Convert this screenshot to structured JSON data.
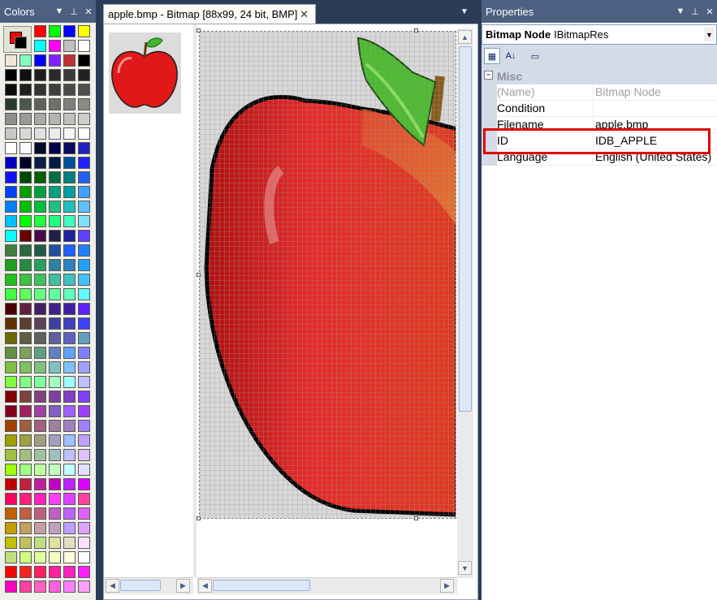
{
  "colors_pane": {
    "title": "Colors",
    "palette": [
      [
        "#ff0000",
        "#00ff00",
        "#0000ff",
        "#ffff00"
      ],
      [
        "#00ffff",
        "#ff00ff",
        "#c0c0c0",
        "#ffffff"
      ],
      [
        "#f3e6d3",
        "#80ffc0",
        "#0000ff",
        "#8020ff",
        "#c03030",
        "#000000"
      ],
      [
        "#000000",
        "#101010",
        "#1e1e1e",
        "#2a2a2a",
        "#3a3a3a",
        "#222222"
      ],
      [
        "#0c0c0c",
        "#202020",
        "#333333",
        "#404040",
        "#4a4a4a",
        "#505050"
      ],
      [
        "#2b3a2a",
        "#4a5a4a",
        "#606060",
        "#707070",
        "#808080",
        "#8a8a8a"
      ],
      [
        "#8f8f8f",
        "#9a9a9a",
        "#a8a8a8",
        "#b4b4b4",
        "#c0c0c0",
        "#cccccc"
      ],
      [
        "#c8c8c8",
        "#d8d8d8",
        "#e0e0e0",
        "#ececec",
        "#f6f6f6",
        "#ffffff"
      ],
      [
        "#ffffff",
        "#fafafa",
        "#000a2a",
        "#00004a",
        "#0a0a60",
        "#2020c0"
      ],
      [
        "#0000c0",
        "#00002a",
        "#0a1a4a",
        "#001a40",
        "#0050a0",
        "#2020ff"
      ],
      [
        "#1010ff",
        "#004a00",
        "#006000",
        "#007040",
        "#008080",
        "#2060ff"
      ],
      [
        "#0040ff",
        "#00a000",
        "#00a040",
        "#00a080",
        "#00a0a0",
        "#40a0ff"
      ],
      [
        "#0080ff",
        "#00c000",
        "#00c040",
        "#20c080",
        "#20c0c0",
        "#60c0ff"
      ],
      [
        "#00c0ff",
        "#00ff00",
        "#20ff40",
        "#20ff80",
        "#40ffc0",
        "#80e0ff"
      ],
      [
        "#00ffff",
        "#6a0000",
        "#4a0a4a",
        "#20204a",
        "#2020a0",
        "#6040ff"
      ],
      [
        "#408040",
        "#2a6a40",
        "#205a4a",
        "#2050a0",
        "#2060ff",
        "#2080ff"
      ],
      [
        "#20a020",
        "#2a8a40",
        "#2aa060",
        "#3080a0",
        "#3080c0",
        "#20a0ff"
      ],
      [
        "#20c020",
        "#40c040",
        "#40c060",
        "#40c0a0",
        "#40c0c0",
        "#40c0ff"
      ],
      [
        "#40ff40",
        "#60ff60",
        "#60ff80",
        "#60ffa0",
        "#60ffc0",
        "#60ffff"
      ],
      [
        "#4a0000",
        "#602040",
        "#402060",
        "#40208a",
        "#4020a0",
        "#6020ff"
      ],
      [
        "#603000",
        "#5a4030",
        "#604060",
        "#4040a0",
        "#4040c0",
        "#4040ff"
      ],
      [
        "#6a6a00",
        "#606040",
        "#606060",
        "#6060a0",
        "#6060c0",
        "#60a0c0"
      ],
      [
        "#609040",
        "#80a060",
        "#60a080",
        "#6080c0",
        "#60a0ff",
        "#8080ff"
      ],
      [
        "#80c040",
        "#80c060",
        "#80c080",
        "#80c0c0",
        "#80c0ff",
        "#a0a0ff"
      ],
      [
        "#80ff40",
        "#80ff80",
        "#80ffa0",
        "#a0ffc0",
        "#a0ffff",
        "#c0c0ff"
      ],
      [
        "#800000",
        "#804040",
        "#804080",
        "#8040a0",
        "#8040c0",
        "#8040ff"
      ],
      [
        "#800020",
        "#a02060",
        "#a040a0",
        "#8060c0",
        "#a060ff",
        "#a040ff"
      ],
      [
        "#a04000",
        "#a06040",
        "#a06080",
        "#a080a0",
        "#a080c0",
        "#a080ff"
      ],
      [
        "#a0a000",
        "#a0a040",
        "#a0a080",
        "#a0a0c0",
        "#a0c0ff",
        "#c0a0ff"
      ],
      [
        "#a0c040",
        "#a0c080",
        "#a0c0a0",
        "#a0c0c0",
        "#c0c0ff",
        "#e0c0ff"
      ],
      [
        "#a0ff00",
        "#a0ff80",
        "#c0ffa0",
        "#c0ffc0",
        "#c0ffff",
        "#e0e0ff"
      ],
      [
        "#c00000",
        "#c02040",
        "#c020a0",
        "#c000c0",
        "#c020ff",
        "#e000ff"
      ],
      [
        "#ff0060",
        "#ff2080",
        "#ff20c0",
        "#ff40ff",
        "#e040ff",
        "#ff40a0"
      ],
      [
        "#c06000",
        "#c06040",
        "#c06080",
        "#c060c0",
        "#c060ff",
        "#e060ff"
      ],
      [
        "#c0a000",
        "#c0a060",
        "#c0a0a0",
        "#c0a0c0",
        "#c0a0ff",
        "#e0a0ff"
      ],
      [
        "#c0c000",
        "#c0c060",
        "#c0e080",
        "#e0e0a0",
        "#e0e0c0",
        "#ffe0ff"
      ],
      [
        "#c0e080",
        "#d0ff80",
        "#e0ffa0",
        "#f0ffc0",
        "#ffffe0",
        "#ffffff"
      ],
      [
        "#ff0000",
        "#ff2020",
        "#ff2060",
        "#ff20a0",
        "#ff20c0",
        "#ff20ff"
      ],
      [
        "#ff00c0",
        "#ff40a0",
        "#ff60c0",
        "#ff60e0",
        "#ff80ff",
        "#ffa0ff"
      ]
    ]
  },
  "tab": {
    "title": "apple.bmp - Bitmap [88x99, 24 bit, BMP]"
  },
  "properties": {
    "title": "Properties",
    "object_name": "Bitmap Node",
    "object_type": "IBitmapRes",
    "category": "Misc",
    "rows": [
      {
        "name": "(Name)",
        "value": "Bitmap Node",
        "disabled": true
      },
      {
        "name": "Condition",
        "value": ""
      },
      {
        "name": "Filename",
        "value": "apple.bmp"
      },
      {
        "name": "ID",
        "value": "IDB_APPLE"
      },
      {
        "name": "Language",
        "value": "English (United States)"
      }
    ]
  },
  "colors": {
    "title_bar": "#4d6082",
    "background": "#2b3c59",
    "highlight": "#e00000",
    "apple_red": "#e02020",
    "leaf_green": "#60d040"
  }
}
